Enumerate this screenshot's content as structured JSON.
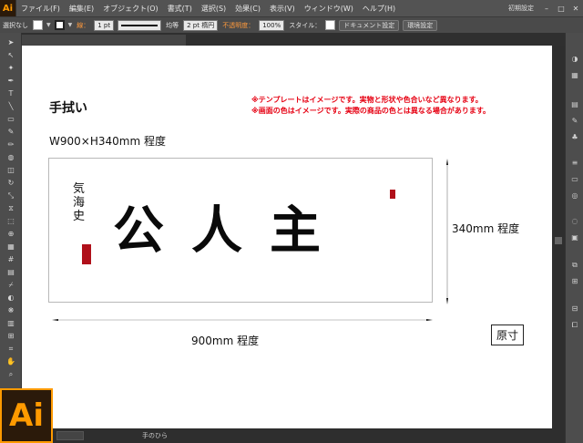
{
  "app": {
    "logo_small": "Ai",
    "logo_big": "Ai",
    "accent": "#ff9a00"
  },
  "menu": {
    "items": [
      "ファイル(F)",
      "編集(E)",
      "オブジェクト(O)",
      "書式(T)",
      "選択(S)",
      "効果(C)",
      "表示(V)",
      "ウィンドウ(W)",
      "ヘルプ(H)"
    ],
    "workspace": "初期設定"
  },
  "control": {
    "selection": "選択なし",
    "stroke_label": "線：",
    "stroke_value": "1 pt",
    "profile": "均等",
    "brush": "2 pt 楕円",
    "opacity_label": "不透明度：",
    "opacity_value": "100%",
    "style_label": "スタイル：",
    "doc_setup": "ドキュメント設定",
    "prefs": "環境設定"
  },
  "statusbar": {
    "tool": "手のひら"
  },
  "artboard": {
    "title": "手拭い",
    "size": "W900×H340mm 程度",
    "notice1": "※テンプレートはイメージです。実物と形状や色合いなど異なります。",
    "notice2": "※画面の色はイメージです。実際の商品の色とは異なる場合があります。",
    "calligraphy": "公人主",
    "signature": "気海史",
    "width_label": "900mm 程度",
    "height_label": "340mm 程度",
    "gensun": "原寸",
    "seal_color": "#b0101a"
  }
}
